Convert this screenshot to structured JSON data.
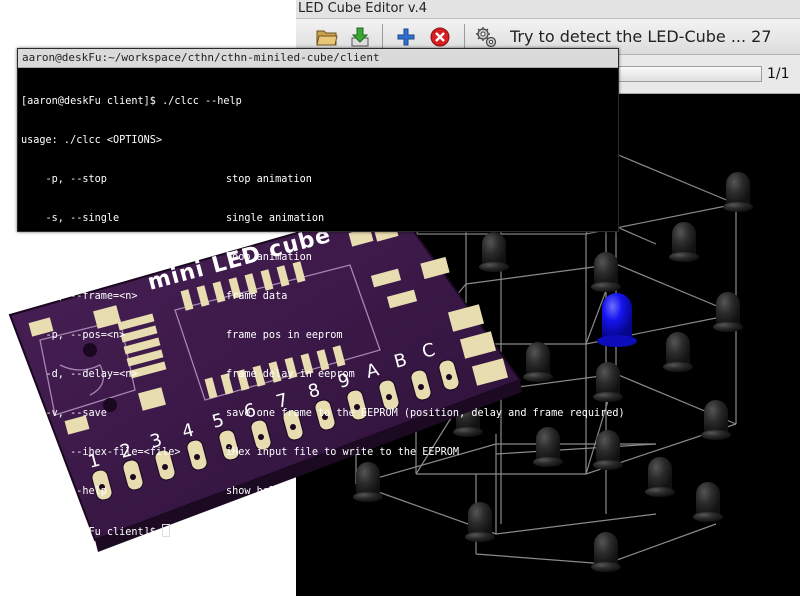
{
  "editor": {
    "title": "LED Cube Editor v.4",
    "toolbar": {
      "icons": [
        "folder-open-icon",
        "download-icon",
        "plus-icon",
        "cancel-icon",
        "gears-icon"
      ],
      "detect_label": "Try to detect the LED-Cube ... 27"
    },
    "frame_counter": "1/1"
  },
  "terminal": {
    "title": "aaron@deskFu:~/workspace/cthn/cthn-miniled-cube/client",
    "prompt_line": "[aaron@deskFu client]$ ./clcc --help",
    "usage_line": "usage: ./clcc <OPTIONS>",
    "options": [
      {
        "flag": "    -p, --stop",
        "desc": "stop animation"
      },
      {
        "flag": "    -s, --single",
        "desc": "single animation"
      },
      {
        "flag": "    -l, --loop",
        "desc": "loop animation"
      },
      {
        "flag": "    -f, --frame=<n>",
        "desc": "frame data"
      },
      {
        "flag": "    -p, --pos=<n>",
        "desc": "frame pos in eeprom"
      },
      {
        "flag": "    -d, --delay=<n>",
        "desc": "frame delay in eeprom"
      },
      {
        "flag": "    -v, --save",
        "desc": "save one frame to the EEPROM (position, delay and frame required)"
      },
      {
        "flag": "    -i, --ihex-file=<file>",
        "desc": "iHex input file to write to the EEPROM"
      },
      {
        "flag": "    -h, --help",
        "desc": "show help"
      }
    ],
    "final_prompt": "[aaron@deskFu client]$ "
  },
  "pcb": {
    "label": "mini LED cube",
    "pin_labels": [
      "1",
      "2",
      "3",
      "4",
      "5",
      "6",
      "7",
      "8",
      "9",
      "A",
      "B",
      "C"
    ],
    "color": "#3a1846"
  },
  "colors": {
    "led_active": "#1111ee",
    "led_inactive": "#2a2a2a",
    "pcb_pad": "#e8ddb0"
  }
}
